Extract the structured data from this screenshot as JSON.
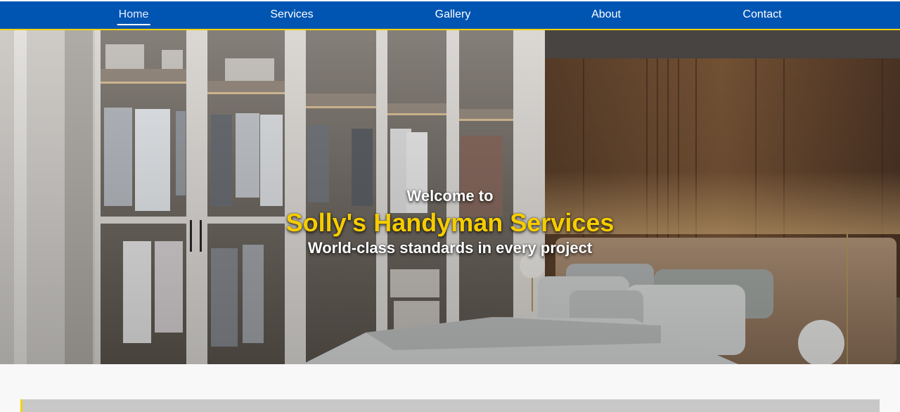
{
  "nav": {
    "items": [
      {
        "label": "Home",
        "active": true
      },
      {
        "label": "Services",
        "active": false
      },
      {
        "label": "Gallery",
        "active": false
      },
      {
        "label": "About",
        "active": false
      },
      {
        "label": "Contact",
        "active": false
      }
    ]
  },
  "hero": {
    "welcome": "Welcome to",
    "title": "Solly's Handyman Services",
    "subtitle": "World-class standards in every project",
    "image": "bedroom-wardrobe-photo"
  },
  "colors": {
    "nav_bg": "#0055b3",
    "accent_yellow": "#f2d100",
    "title_yellow": "#f5cc00",
    "text_white": "#ffffff"
  }
}
